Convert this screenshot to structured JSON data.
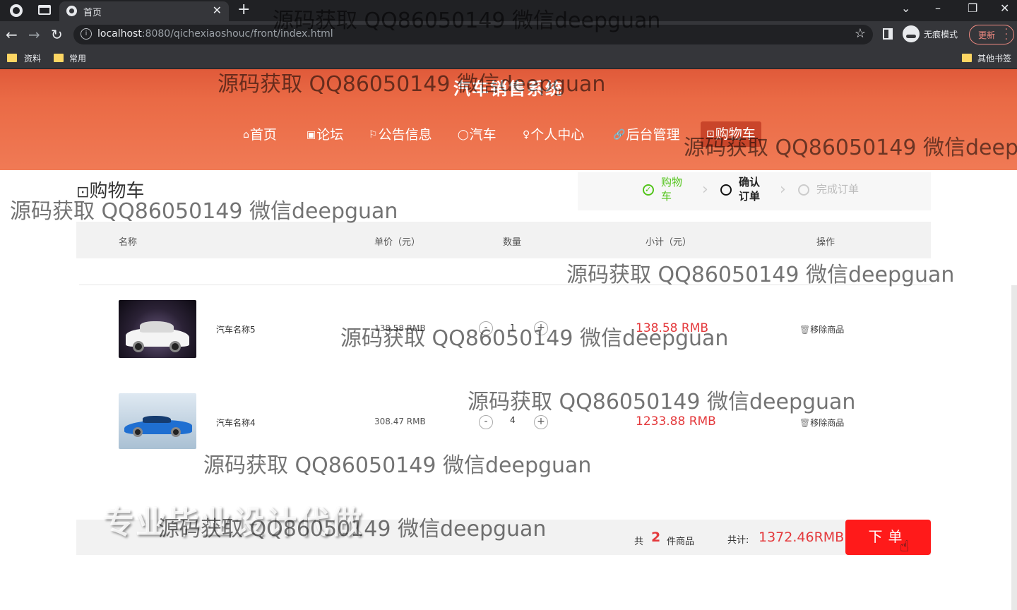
{
  "browser": {
    "tab_title": "首页",
    "url_host": "localhost",
    "url_rest": ":8080/qichexiaoshouc/front/index.html",
    "incognito_label": "无痕模式",
    "update_label": "更新",
    "bookmarks": [
      {
        "label": "资料"
      },
      {
        "label": "常用"
      }
    ],
    "other_bookmarks": "其他书签"
  },
  "site": {
    "title": "汽车销售系统",
    "nav": [
      {
        "icon": "⌂",
        "label": "首页"
      },
      {
        "icon": "▣",
        "label": "论坛"
      },
      {
        "icon": "⚐",
        "label": "公告信息"
      },
      {
        "icon": "◯",
        "label": "汽车"
      },
      {
        "icon": "♀",
        "label": "个人中心"
      },
      {
        "icon": "🔗",
        "label": "后台管理"
      },
      {
        "icon": "⊡",
        "label": "购物车"
      }
    ]
  },
  "cart": {
    "heading": "购物车",
    "steps": [
      {
        "label": "购物车",
        "state": "done"
      },
      {
        "label": "确认订单",
        "state": "current"
      },
      {
        "label": "完成订单",
        "state": "todo"
      }
    ],
    "columns": [
      "名称",
      "单价（元）",
      "数量",
      "小计（元）",
      "操作"
    ],
    "items": [
      {
        "name": "汽车名称5",
        "price": "138.58 RMB",
        "qty": "1",
        "subtotal": "138.58 RMB",
        "remove": "移除商品"
      },
      {
        "name": "汽车名称4",
        "price": "308.47 RMB",
        "qty": "4",
        "subtotal": "1233.88 RMB",
        "remove": "移除商品"
      }
    ],
    "summary": {
      "count_prefix": "共",
      "count": "2",
      "count_suffix": "件商品",
      "total_label": "共计:",
      "total_value": "1372.46RMB",
      "order_button": "下单"
    }
  },
  "overlay": {
    "promo": "专业毕业设计代做",
    "watermark": "源码获取 QQ86050149 微信deepguan"
  },
  "colors": {
    "header": "#ea6a45",
    "accent_red": "#e4393c",
    "order_button": "#ff1a1a",
    "step_done": "#52c41a"
  }
}
